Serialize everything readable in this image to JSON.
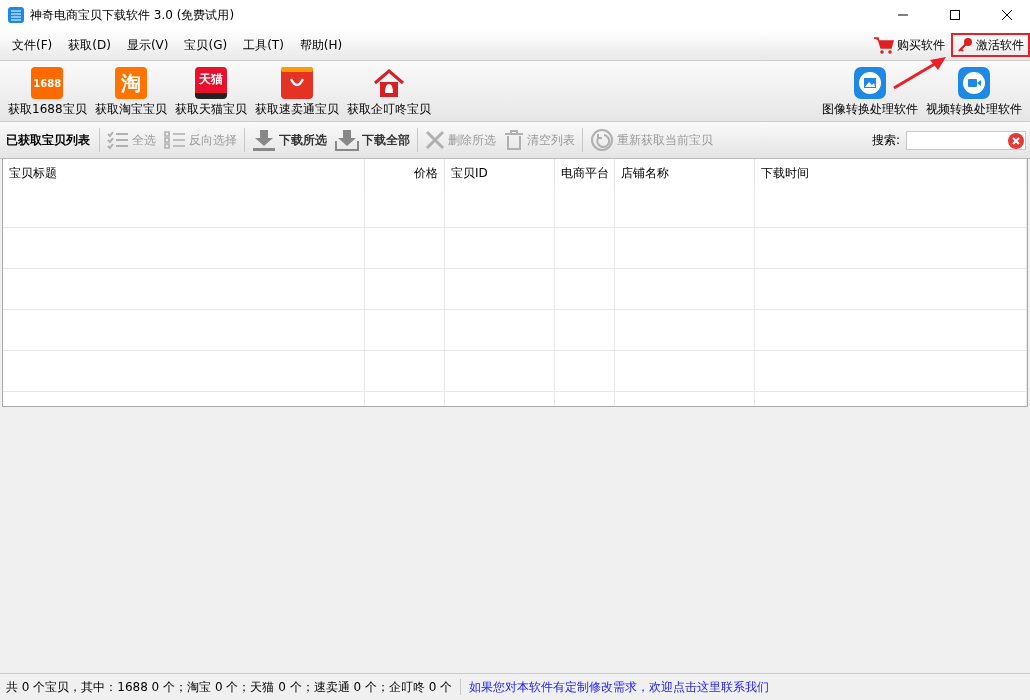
{
  "window": {
    "title": "神奇电商宝贝下载软件 3.0 (免费试用)"
  },
  "menu": [
    "文件(F)",
    "获取(D)",
    "显示(V)",
    "宝贝(G)",
    "工具(T)",
    "帮助(H)"
  ],
  "menu_right": [
    {
      "kind": "cart",
      "label": "购买软件",
      "highlighted": false
    },
    {
      "kind": "key",
      "label": "激活软件",
      "highlighted": true
    }
  ],
  "toolbar_left": [
    {
      "kind": "alibaba",
      "logo": "1688",
      "label": "获取1688宝贝"
    },
    {
      "kind": "taobao",
      "logo": "淘",
      "label": "获取淘宝宝贝"
    },
    {
      "kind": "tmall",
      "logo": "天猫",
      "label": "获取天猫宝贝"
    },
    {
      "kind": "aliexpress",
      "label": "获取速卖通宝贝"
    },
    {
      "kind": "house",
      "label": "获取企叮咚宝贝"
    }
  ],
  "toolbar_right": [
    {
      "kind": "image",
      "label": "图像转换处理软件"
    },
    {
      "kind": "video",
      "label": "视频转换处理软件"
    }
  ],
  "list_toolbar": {
    "title": "已获取宝贝列表",
    "items": [
      {
        "kind": "checklist",
        "label": "全选",
        "disabled": true
      },
      {
        "kind": "list",
        "label": "反向选择",
        "disabled": true
      },
      {
        "kind": "download",
        "label": "下载所选",
        "disabled": false
      },
      {
        "kind": "download-tray",
        "label": "下载全部",
        "disabled": false
      },
      {
        "kind": "x",
        "label": "删除所选",
        "disabled": true
      },
      {
        "kind": "trash",
        "label": "清空列表",
        "disabled": true
      },
      {
        "kind": "refresh",
        "label": "重新获取当前宝贝",
        "disabled": true
      }
    ],
    "search_label": "搜索:"
  },
  "table": {
    "columns": [
      {
        "label": "宝贝标题"
      },
      {
        "label": "价格"
      },
      {
        "label": "宝贝ID"
      },
      {
        "label": "电商平台"
      },
      {
        "label": "店铺名称"
      },
      {
        "label": "下载时间"
      }
    ]
  },
  "status_bar": {
    "summary": "共 0 个宝贝，其中：1688 0 个；淘宝 0 个；天猫 0 个；速卖通 0 个；企叮咚 0 个",
    "link": "如果您对本软件有定制修改需求，欢迎点击这里联系我们"
  }
}
